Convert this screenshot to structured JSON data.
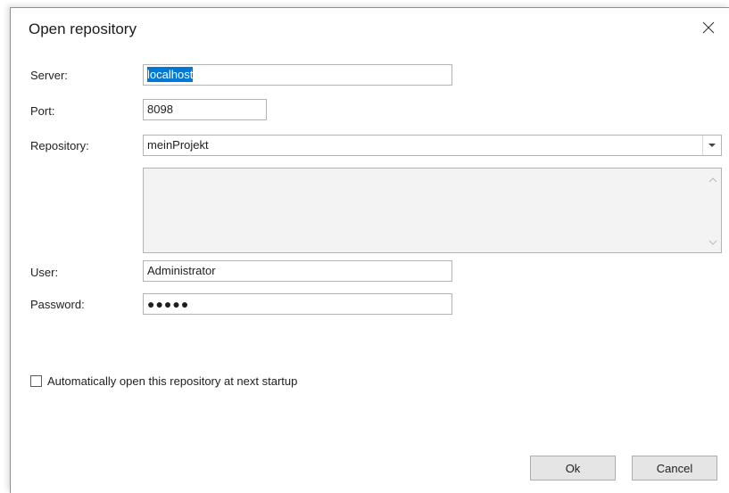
{
  "dialog": {
    "title": "Open repository",
    "close_icon": "close-icon"
  },
  "form": {
    "server": {
      "label": "Server:",
      "value": "localhost",
      "selected": true
    },
    "port": {
      "label": "Port:",
      "value": "8098"
    },
    "repository": {
      "label": "Repository:",
      "value": "meinProjekt",
      "dropdown_icon": "chevron-down-icon"
    },
    "description": {
      "value": ""
    },
    "user": {
      "label": "User:",
      "value": "Administrator"
    },
    "password": {
      "label": "Password:",
      "masked_value": "●●●●●"
    }
  },
  "auto_open": {
    "label": "Automatically open this repository at next startup",
    "checked": false
  },
  "buttons": {
    "ok_label": "Ok",
    "cancel_label": "Cancel"
  },
  "colors": {
    "selection": "#0078d7",
    "border": "#b4b4b4",
    "button_face": "#e5e5e5",
    "disabled_bg": "#f3f3f3"
  }
}
